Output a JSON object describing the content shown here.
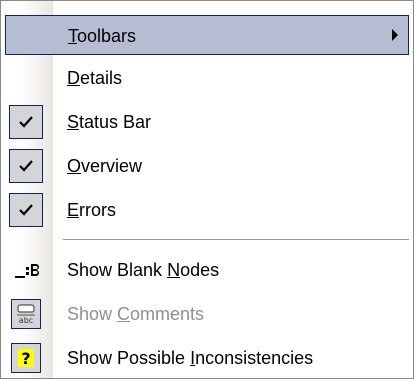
{
  "menu": {
    "items": [
      {
        "label_before": "",
        "mnemonic": "T",
        "label_after": "oolbars",
        "has_submenu": true,
        "state": "highlighted"
      },
      {
        "label_before": "",
        "mnemonic": "D",
        "label_after": "etails",
        "has_submenu": false,
        "state": "normal"
      },
      {
        "label_before": "",
        "mnemonic": "S",
        "label_after": "tatus Bar",
        "checked": true,
        "state": "normal"
      },
      {
        "label_before": "",
        "mnemonic": "O",
        "label_after": "verview",
        "checked": true,
        "state": "normal"
      },
      {
        "label_before": "",
        "mnemonic": "E",
        "label_after": "rrors",
        "checked": true,
        "state": "normal"
      },
      {
        "label_before": "Show Blank ",
        "mnemonic": "N",
        "label_after": "odes",
        "icon": "blank-nodes-icon",
        "state": "normal"
      },
      {
        "label_before": "Show ",
        "mnemonic": "C",
        "label_after": "omments",
        "icon": "comments-icon",
        "state": "disabled"
      },
      {
        "label_before": "Show Possible ",
        "mnemonic": "I",
        "label_after": "nconsistencies",
        "icon": "question-icon",
        "state": "checked-icon"
      }
    ]
  },
  "colors": {
    "highlight_bg": "#b6bdd2",
    "highlight_border": "#0a246a",
    "check_bg": "#d4d5d8",
    "disabled_text": "#8f8f8f",
    "question_yellow": "#ffff00"
  }
}
